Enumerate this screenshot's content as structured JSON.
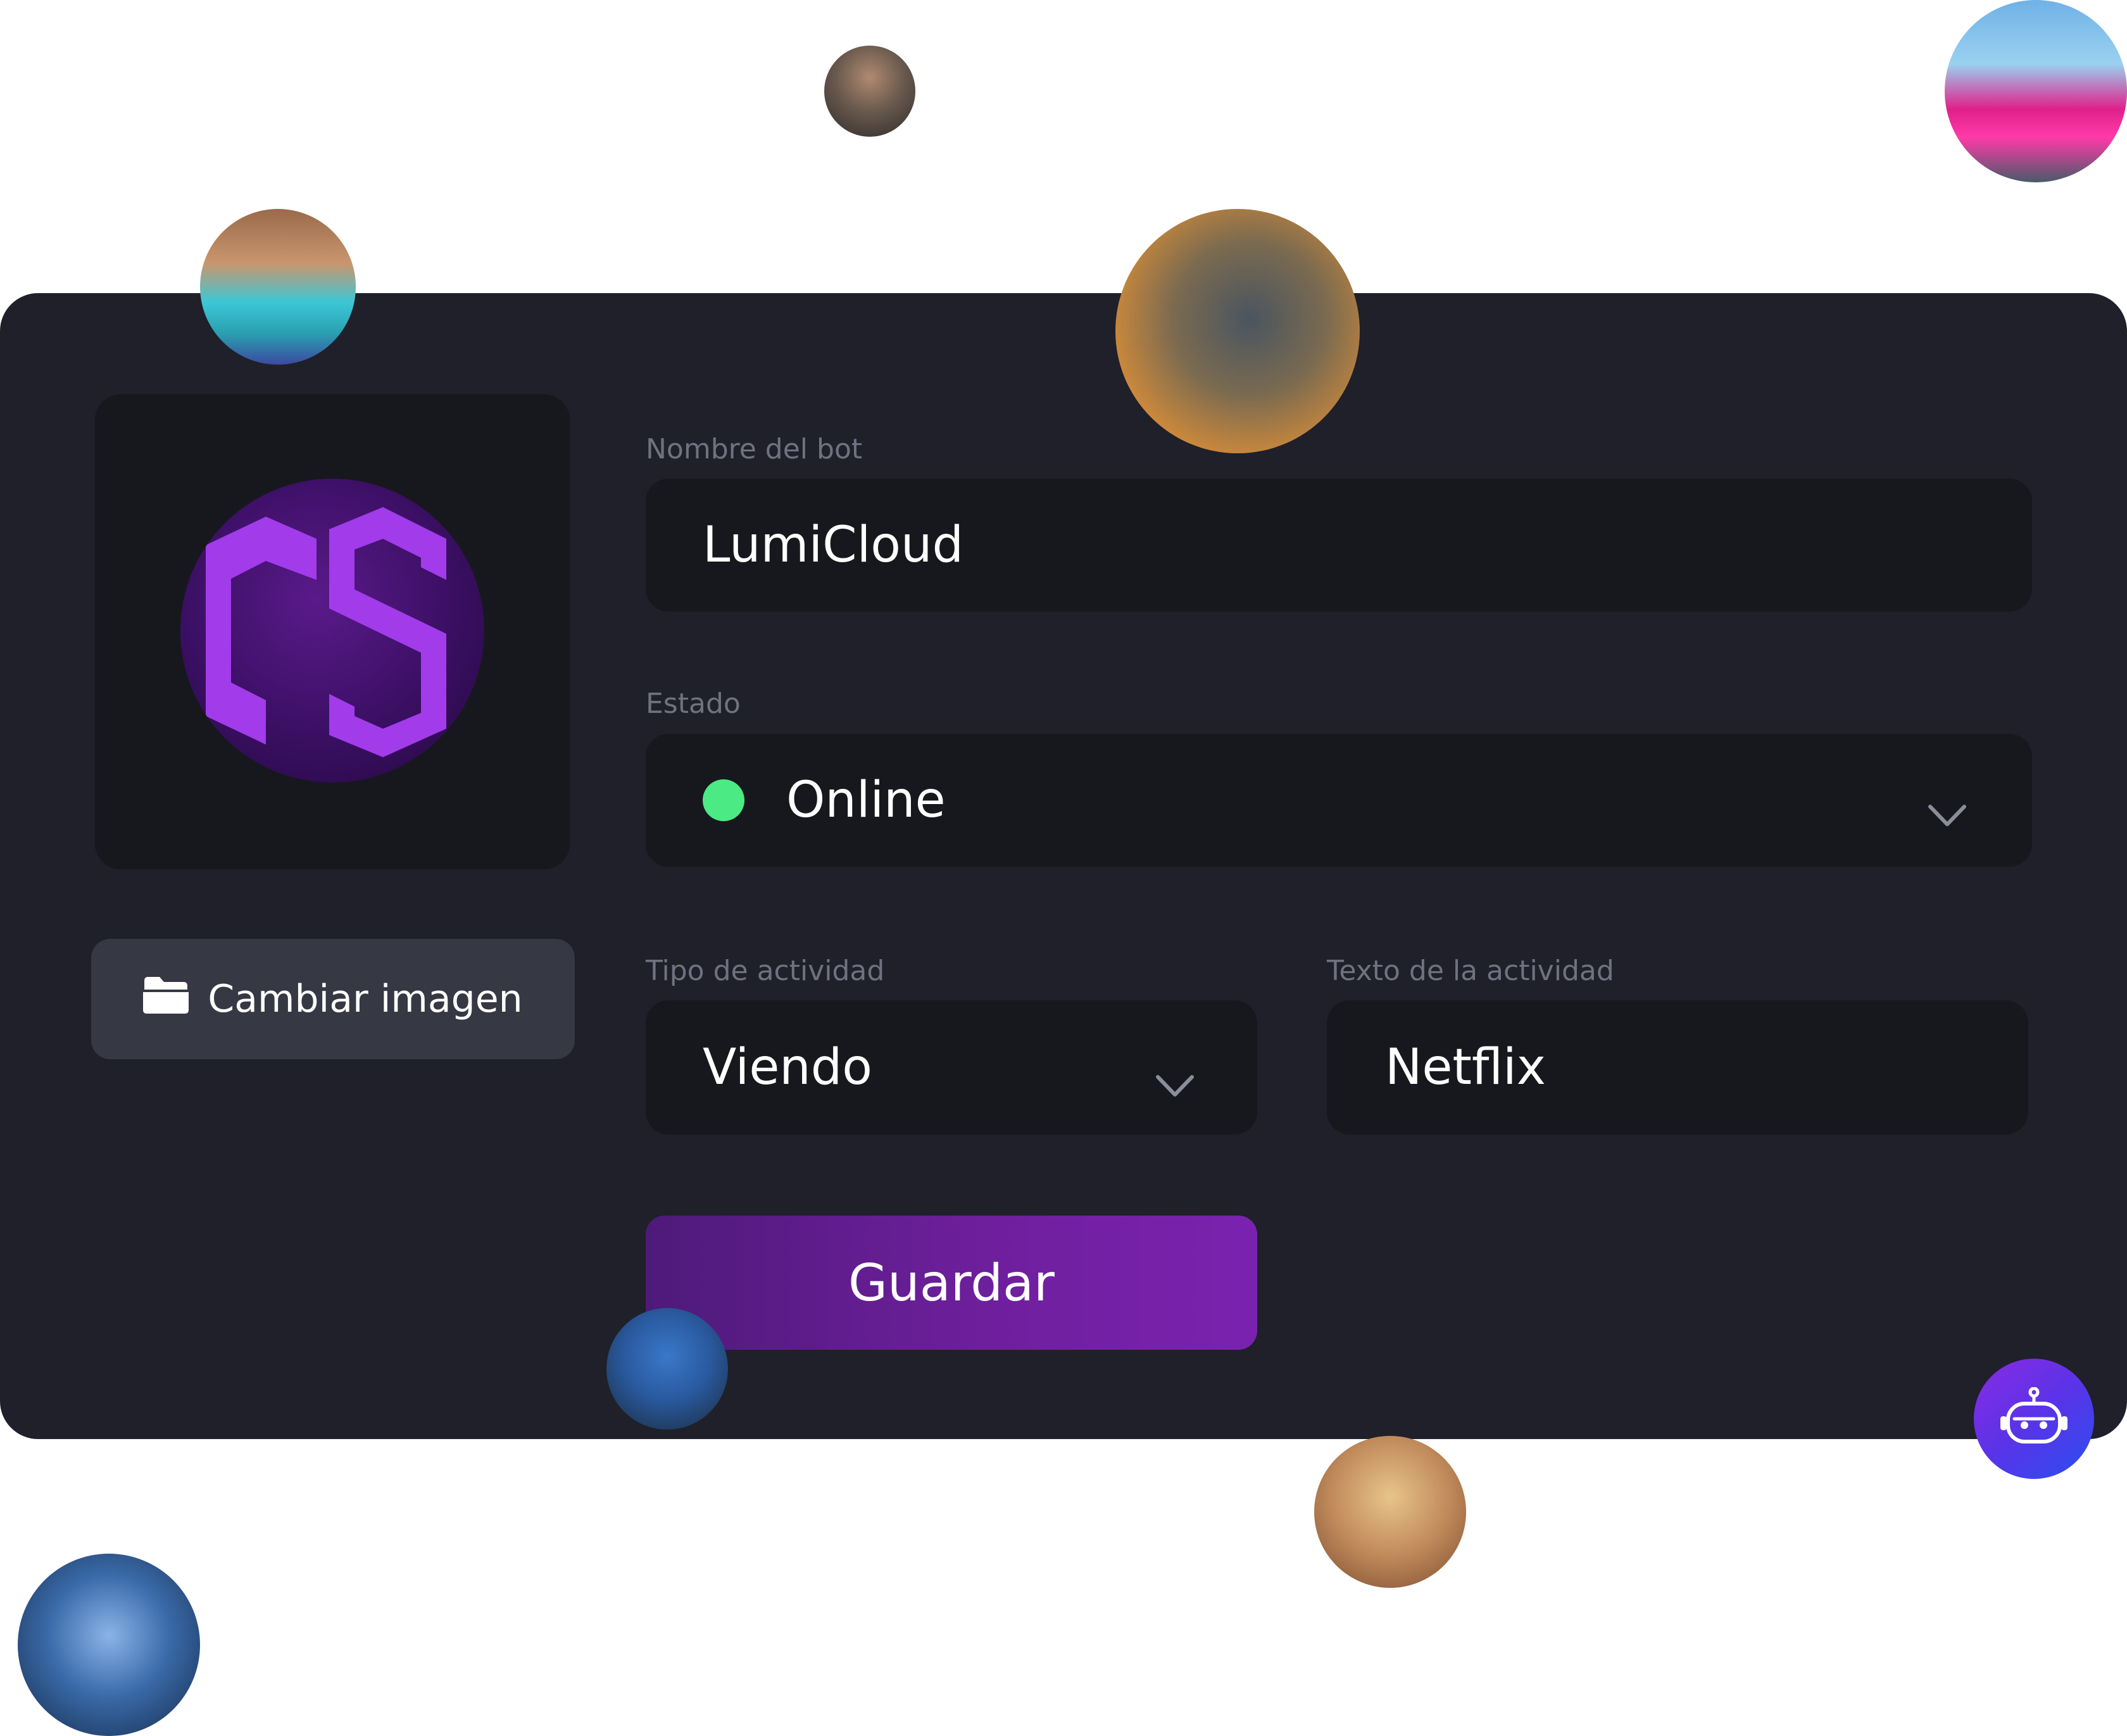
{
  "bot": {
    "name_label": "Nombre del bot",
    "name_value": "LumiCloud",
    "status_label": "Estado",
    "status_value": "Online",
    "status_color": "#4cea85",
    "activity_type_label": "Tipo de actividad",
    "activity_type_value": "Viendo",
    "activity_text_label": "Texto de la actividad",
    "activity_text_value": "Netflix"
  },
  "image": {
    "change_label": "Cambiar imagen",
    "change_icon": "folder-icon",
    "logo": "ds-logo"
  },
  "actions": {
    "save_label": "Guardar"
  },
  "colors": {
    "card": "#1f2029",
    "field": "#17181d",
    "accent": "#7a22b0"
  },
  "decorations": {
    "avatars": [
      "warrior-avatar",
      "pink-car-avatar",
      "blocky-miner-avatar",
      "robot-mech-avatar",
      "blue-creature-avatar",
      "blonde-woman-avatar",
      "mech-factory-avatar"
    ],
    "assistant_icon": "robot-icon"
  }
}
